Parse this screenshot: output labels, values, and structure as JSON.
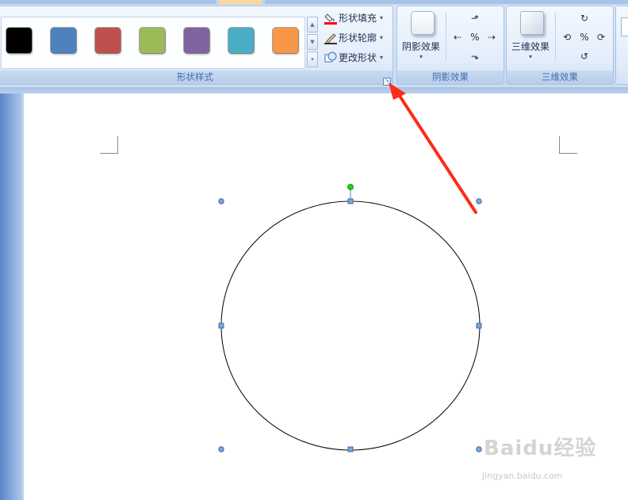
{
  "ribbon": {
    "shape_styles": {
      "label": "形状样式",
      "swatches": [
        "#000000",
        "#4f81bd",
        "#c0504d",
        "#9bbb59",
        "#8064a2",
        "#4bacc6",
        "#f79646"
      ],
      "commands": [
        {
          "label": "形状填充",
          "icon": "paint-bucket-icon"
        },
        {
          "label": "形状轮廓",
          "icon": "pencil-outline-icon"
        },
        {
          "label": "更改形状",
          "icon": "change-shape-icon"
        }
      ]
    },
    "shadow_effects": {
      "label": "阴影效果",
      "button_label": "阴影效果"
    },
    "threed_effects": {
      "label": "三维效果",
      "button_label": "三维效果"
    }
  },
  "watermark": {
    "brand": "Baidu经验",
    "url": "jingyan.baidu.com"
  },
  "colors": {
    "annotation_arrow": "#ff2a1a",
    "handle": "#4f81bd",
    "rotate_handle": "#22cc22"
  }
}
